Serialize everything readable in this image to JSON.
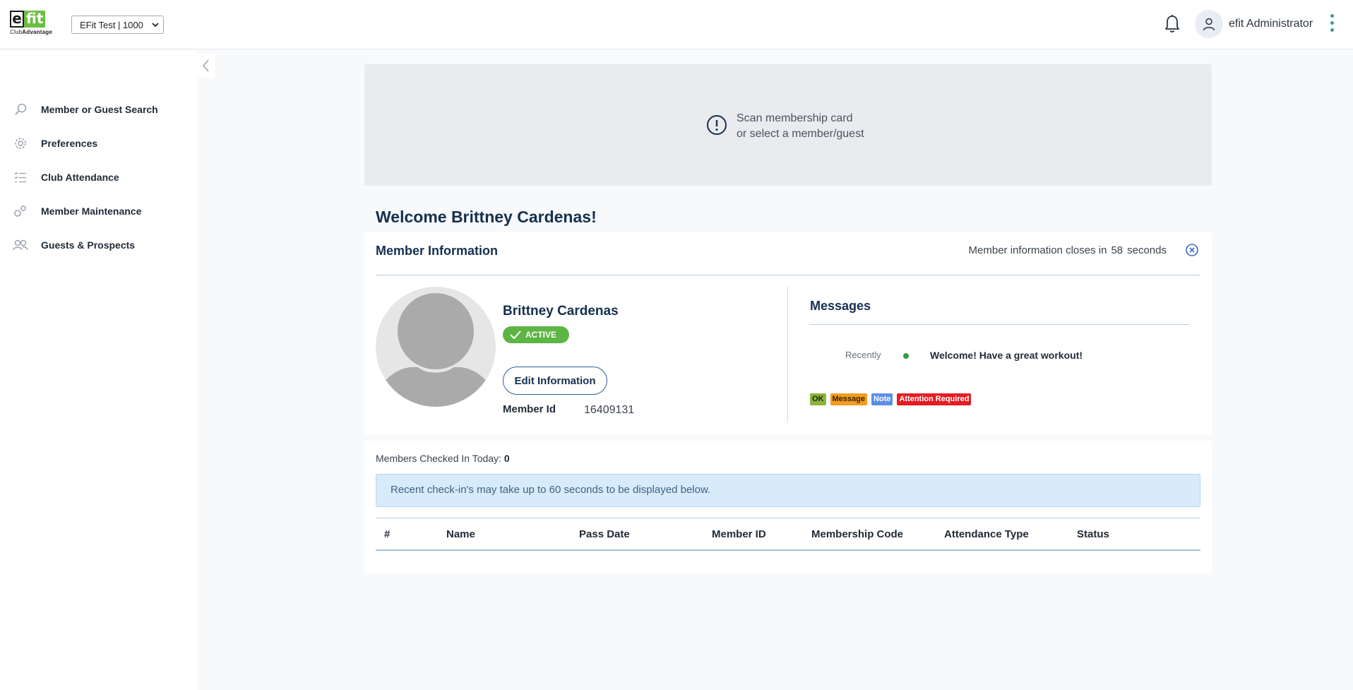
{
  "header": {
    "logo_text_e": "e",
    "logo_text_fit": "fit",
    "logo_sub_club": "Club",
    "logo_sub_advantage": "Advantage",
    "club_select_value": "EFit Test | 1000",
    "user_name": "efit Administrator"
  },
  "sidebar": {
    "items": [
      {
        "label": "Member or Guest Search",
        "icon": "search-icon"
      },
      {
        "label": "Preferences",
        "icon": "gear-icon"
      },
      {
        "label": "Club Attendance",
        "icon": "checklist-icon"
      },
      {
        "label": "Member Maintenance",
        "icon": "gears-icon"
      },
      {
        "label": "Guests & Prospects",
        "icon": "people-icon"
      }
    ]
  },
  "scan": {
    "line1": "Scan membership card",
    "line2": "or select a member/guest"
  },
  "welcome": "Welcome Brittney Cardenas!",
  "member_info": {
    "title": "Member Information",
    "closes_prefix": "Member information closes in",
    "closes_seconds": "58",
    "closes_suffix": "seconds",
    "name": "Brittney Cardenas",
    "status": "ACTIVE",
    "edit_button": "Edit Information",
    "member_id_label": "Member Id",
    "member_id_value": "16409131"
  },
  "messages": {
    "title": "Messages",
    "items": [
      {
        "when": "Recently",
        "text": "Welcome! Have a great workout!",
        "color": "#2e9d44"
      }
    ],
    "legend": [
      "OK",
      "Message",
      "Note",
      "Attention Required"
    ]
  },
  "checkins": {
    "count_label": "Members Checked In Today:",
    "count_value": "0",
    "alert": "Recent check-in's may take up to 60 seconds to be displayed below.",
    "columns": [
      "#",
      "Name",
      "Pass Date",
      "Member ID",
      "Membership Code",
      "Attendance Type",
      "Status"
    ]
  },
  "colors": {
    "brand_green": "#6cbf3f",
    "active_green": "#5db544",
    "heading_navy": "#15304f",
    "accent_teal": "#3a9b9b"
  }
}
